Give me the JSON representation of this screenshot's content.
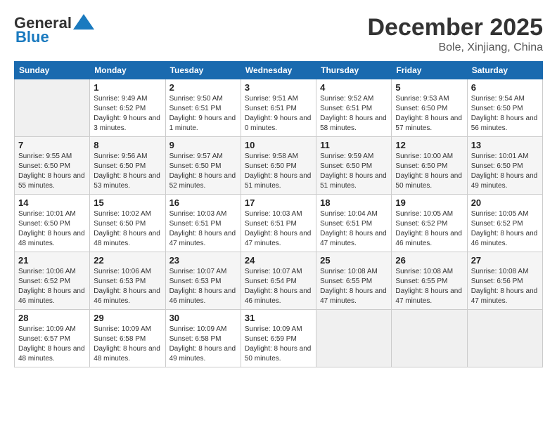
{
  "header": {
    "logo_line1": "General",
    "logo_line2": "Blue",
    "month": "December 2025",
    "location": "Bole, Xinjiang, China"
  },
  "weekdays": [
    "Sunday",
    "Monday",
    "Tuesday",
    "Wednesday",
    "Thursday",
    "Friday",
    "Saturday"
  ],
  "weeks": [
    [
      {
        "day": "",
        "sunrise": "",
        "sunset": "",
        "daylight": ""
      },
      {
        "day": "1",
        "sunrise": "9:49 AM",
        "sunset": "6:52 PM",
        "daylight": "9 hours and 3 minutes."
      },
      {
        "day": "2",
        "sunrise": "9:50 AM",
        "sunset": "6:51 PM",
        "daylight": "9 hours and 1 minute."
      },
      {
        "day": "3",
        "sunrise": "9:51 AM",
        "sunset": "6:51 PM",
        "daylight": "9 hours and 0 minutes."
      },
      {
        "day": "4",
        "sunrise": "9:52 AM",
        "sunset": "6:51 PM",
        "daylight": "8 hours and 58 minutes."
      },
      {
        "day": "5",
        "sunrise": "9:53 AM",
        "sunset": "6:50 PM",
        "daylight": "8 hours and 57 minutes."
      },
      {
        "day": "6",
        "sunrise": "9:54 AM",
        "sunset": "6:50 PM",
        "daylight": "8 hours and 56 minutes."
      }
    ],
    [
      {
        "day": "7",
        "sunrise": "9:55 AM",
        "sunset": "6:50 PM",
        "daylight": "8 hours and 55 minutes."
      },
      {
        "day": "8",
        "sunrise": "9:56 AM",
        "sunset": "6:50 PM",
        "daylight": "8 hours and 53 minutes."
      },
      {
        "day": "9",
        "sunrise": "9:57 AM",
        "sunset": "6:50 PM",
        "daylight": "8 hours and 52 minutes."
      },
      {
        "day": "10",
        "sunrise": "9:58 AM",
        "sunset": "6:50 PM",
        "daylight": "8 hours and 51 minutes."
      },
      {
        "day": "11",
        "sunrise": "9:59 AM",
        "sunset": "6:50 PM",
        "daylight": "8 hours and 51 minutes."
      },
      {
        "day": "12",
        "sunrise": "10:00 AM",
        "sunset": "6:50 PM",
        "daylight": "8 hours and 50 minutes."
      },
      {
        "day": "13",
        "sunrise": "10:01 AM",
        "sunset": "6:50 PM",
        "daylight": "8 hours and 49 minutes."
      }
    ],
    [
      {
        "day": "14",
        "sunrise": "10:01 AM",
        "sunset": "6:50 PM",
        "daylight": "8 hours and 48 minutes."
      },
      {
        "day": "15",
        "sunrise": "10:02 AM",
        "sunset": "6:50 PM",
        "daylight": "8 hours and 48 minutes."
      },
      {
        "day": "16",
        "sunrise": "10:03 AM",
        "sunset": "6:51 PM",
        "daylight": "8 hours and 47 minutes."
      },
      {
        "day": "17",
        "sunrise": "10:03 AM",
        "sunset": "6:51 PM",
        "daylight": "8 hours and 47 minutes."
      },
      {
        "day": "18",
        "sunrise": "10:04 AM",
        "sunset": "6:51 PM",
        "daylight": "8 hours and 47 minutes."
      },
      {
        "day": "19",
        "sunrise": "10:05 AM",
        "sunset": "6:52 PM",
        "daylight": "8 hours and 46 minutes."
      },
      {
        "day": "20",
        "sunrise": "10:05 AM",
        "sunset": "6:52 PM",
        "daylight": "8 hours and 46 minutes."
      }
    ],
    [
      {
        "day": "21",
        "sunrise": "10:06 AM",
        "sunset": "6:52 PM",
        "daylight": "8 hours and 46 minutes."
      },
      {
        "day": "22",
        "sunrise": "10:06 AM",
        "sunset": "6:53 PM",
        "daylight": "8 hours and 46 minutes."
      },
      {
        "day": "23",
        "sunrise": "10:07 AM",
        "sunset": "6:53 PM",
        "daylight": "8 hours and 46 minutes."
      },
      {
        "day": "24",
        "sunrise": "10:07 AM",
        "sunset": "6:54 PM",
        "daylight": "8 hours and 46 minutes."
      },
      {
        "day": "25",
        "sunrise": "10:08 AM",
        "sunset": "6:55 PM",
        "daylight": "8 hours and 47 minutes."
      },
      {
        "day": "26",
        "sunrise": "10:08 AM",
        "sunset": "6:55 PM",
        "daylight": "8 hours and 47 minutes."
      },
      {
        "day": "27",
        "sunrise": "10:08 AM",
        "sunset": "6:56 PM",
        "daylight": "8 hours and 47 minutes."
      }
    ],
    [
      {
        "day": "28",
        "sunrise": "10:09 AM",
        "sunset": "6:57 PM",
        "daylight": "8 hours and 48 minutes."
      },
      {
        "day": "29",
        "sunrise": "10:09 AM",
        "sunset": "6:58 PM",
        "daylight": "8 hours and 48 minutes."
      },
      {
        "day": "30",
        "sunrise": "10:09 AM",
        "sunset": "6:58 PM",
        "daylight": "8 hours and 49 minutes."
      },
      {
        "day": "31",
        "sunrise": "10:09 AM",
        "sunset": "6:59 PM",
        "daylight": "8 hours and 50 minutes."
      },
      {
        "day": "",
        "sunrise": "",
        "sunset": "",
        "daylight": ""
      },
      {
        "day": "",
        "sunrise": "",
        "sunset": "",
        "daylight": ""
      },
      {
        "day": "",
        "sunrise": "",
        "sunset": "",
        "daylight": ""
      }
    ]
  ]
}
